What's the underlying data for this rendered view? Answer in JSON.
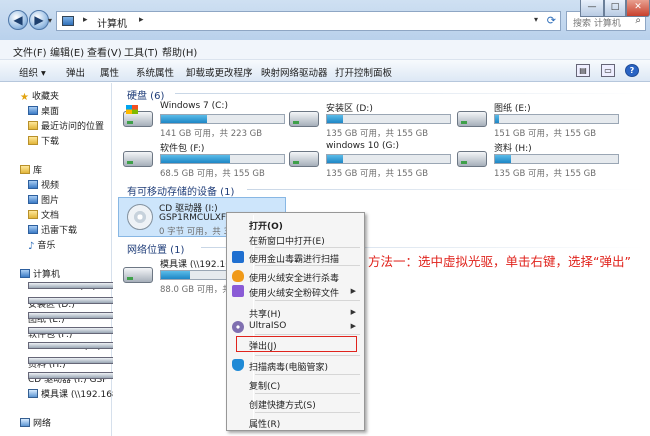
{
  "window": {
    "address": {
      "crumb": "计算机",
      "sep": "▸"
    },
    "search_placeholder": "搜索 计算机",
    "controls": {
      "min": "—",
      "max": "□",
      "close": "✕"
    }
  },
  "menu": [
    "文件(F)",
    "编辑(E)",
    "查看(V)",
    "工具(T)",
    "帮助(H)"
  ],
  "toolbar": [
    "组织 ▾",
    "弹出",
    "属性",
    "系统属性",
    "卸载或更改程序",
    "映射网络驱动器",
    "打开控制面板"
  ],
  "nav": {
    "favorites": "收藏夹",
    "desktop": "桌面",
    "recent": "最近访问的位置",
    "downloads": "下载",
    "library": "库",
    "video": "视频",
    "pictures": "图片",
    "documents": "文档",
    "thunder": "迅雷下载",
    "music": "音乐",
    "computer": "计算机",
    "drives": [
      "Windows 7 (C:)",
      "安装区 (D:)",
      "图纸 (E:)",
      "软件包 (F:)",
      "windows 10 (G:)",
      "资料 (H:)",
      "CD 驱动器 (I:) GSP",
      "模具课 (\\\\192.168.0"
    ],
    "network": "网络"
  },
  "groups": {
    "hdd": "硬盘 (6)",
    "removable": "有可移动存储的设备 (1)",
    "network": "网络位置 (1)"
  },
  "drives": [
    {
      "name": "Windows 7 (C:)",
      "free": "141 GB 可用，共 223 GB",
      "used": 0.37
    },
    {
      "name": "安装区 (D:)",
      "free": "135 GB 可用，共 155 GB",
      "used": 0.13
    },
    {
      "name": "图纸 (E:)",
      "free": "151 GB 可用，共 155 GB",
      "used": 0.03
    },
    {
      "name": "软件包 (F:)",
      "free": "68.5 GB 可用，共 155 GB",
      "used": 0.56
    },
    {
      "name": "windows 10 (G:)",
      "free": "135 GB 可用，共 155 GB",
      "used": 0.13
    },
    {
      "name": "资料 (H:)",
      "free": "135 GB 可用，共 155 GB",
      "used": 0.13
    }
  ],
  "cd": {
    "name": "CD 驱动器 (I:)",
    "label": "GSP1RMCULXFRE",
    "free": "0 字节 可用，共 3."
  },
  "netloc": {
    "name": "模具课 (\\\\192.168",
    "free": "88.0 GB 可用，共 15",
    "used": 0.42
  },
  "context_menu": {
    "open": "打开(O)",
    "open_new": "在新窗口中打开(E)",
    "jinshan": "使用金山毒霸进行扫描",
    "huorong_kill": "使用火绒安全进行杀毒",
    "huorong_shred": "使用火绒安全粉碎文件",
    "share": "共享(H)",
    "ultraiso": "UltraISO",
    "eject": "弹出(J)",
    "scan": "扫描病毒(电脑管家)",
    "copy": "复制(C)",
    "shortcut": "创建快捷方式(S)",
    "properties": "属性(R)"
  },
  "annotation": "方法一：选中虚拟光驱，单击右键，选择“弹出”"
}
